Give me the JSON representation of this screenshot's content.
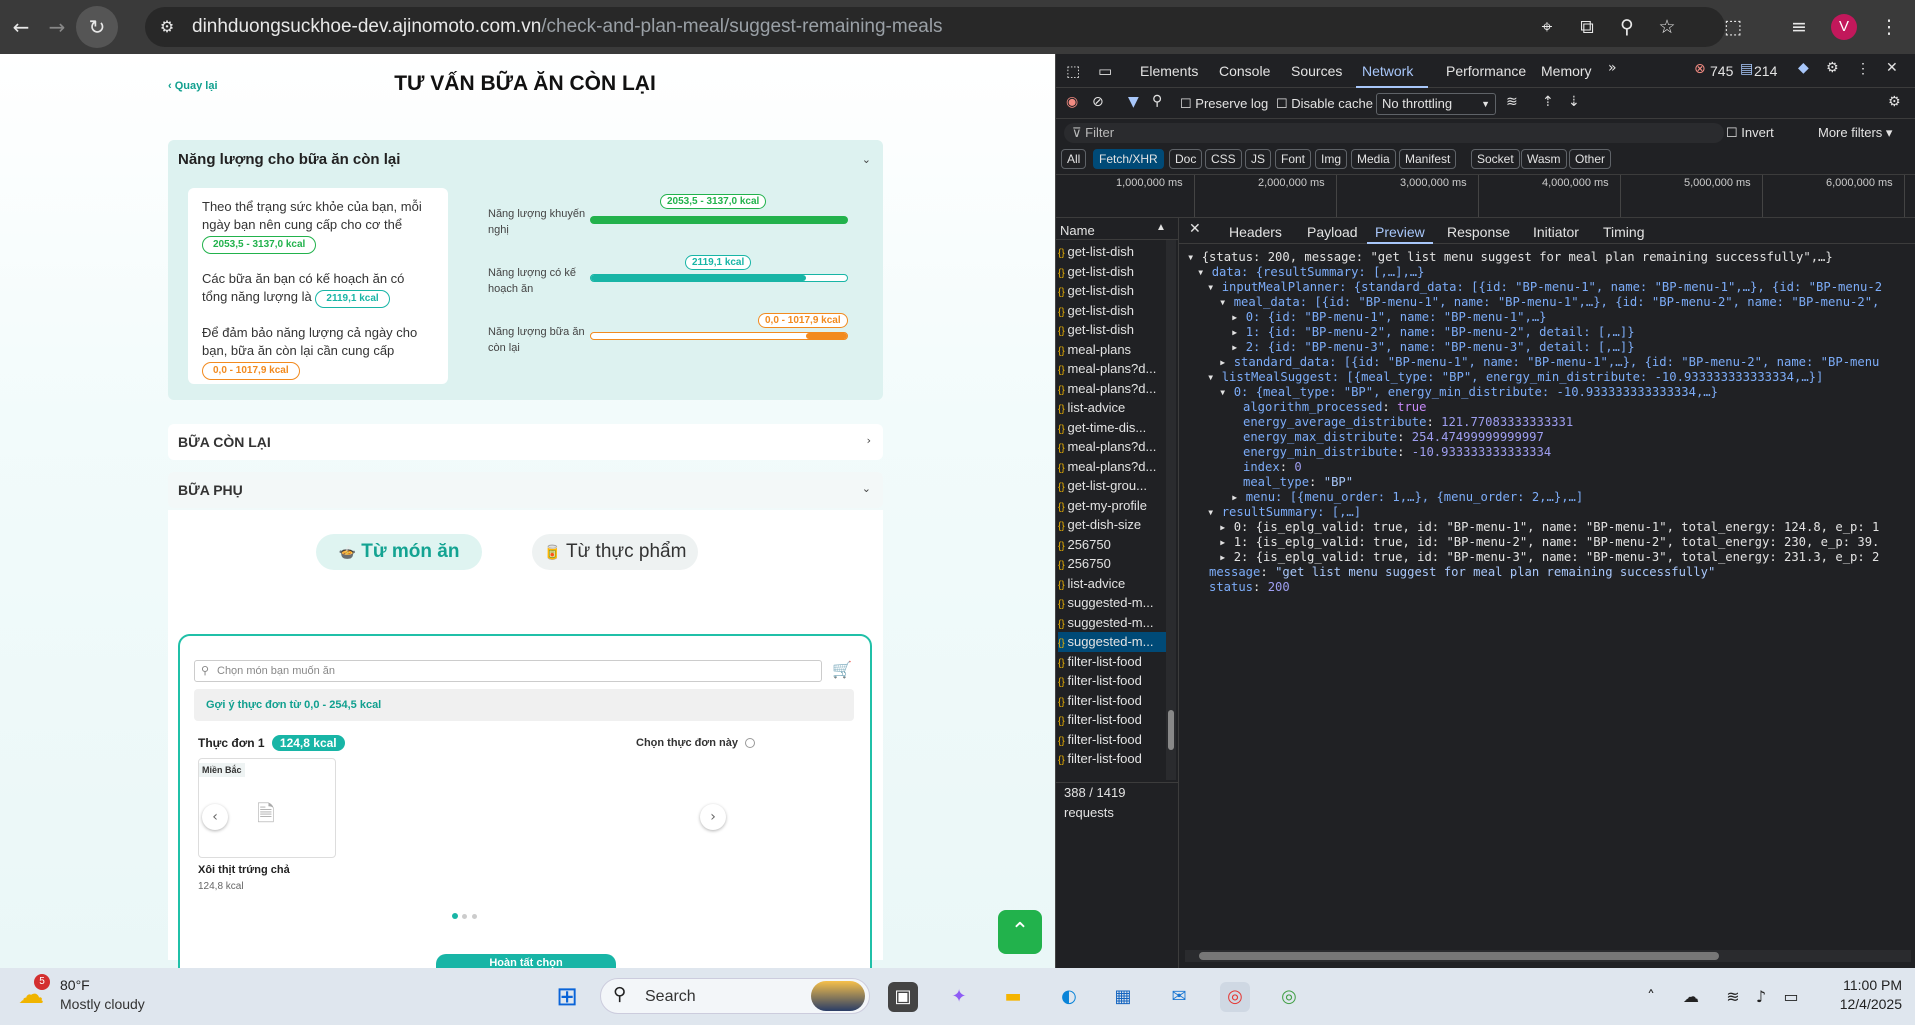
{
  "browser": {
    "url_host": "dinhduongsuckhoe-dev.ajinomoto.com.vn",
    "url_path": "/check-and-plan-meal/suggest-remaining-meals",
    "avatar_letter": "V"
  },
  "page": {
    "back_label": "Quay lại",
    "title": "TƯ VẤN BỮA ĂN CÒN LẠI",
    "energy_section": {
      "title": "Năng lượng cho bữa ăn còn lại",
      "info1_text": "Theo thể trạng sức khỏe của bạn, mỗi ngày bạn nên cung cấp cho cơ thể",
      "info1_value": "2053,5 - 3137,0 kcal",
      "info2_text": "Các bữa ăn bạn có kế hoạch ăn có tổng năng lượng là",
      "info2_value": "2119,1 kcal",
      "info3_text": "Để đảm bảo năng lượng cả ngày cho bạn, bữa ăn còn lại cần cung cấp",
      "info3_value": "0,0 - 1017,9 kcal",
      "bar1_label": "Năng lượng khuyến nghị",
      "bar1_value": "2053,5 - 3137,0 kcal",
      "bar1_fill": 1.0,
      "bar2_label": "Năng lượng có kế hoạch ăn",
      "bar2_value": "2119,1 kcal",
      "bar2_fill": 0.84,
      "bar3_label": "Năng lượng bữa ăn còn lại",
      "bar3_value": "0,0 - 1017,9 kcal",
      "bar3_fill_start": 0.84,
      "colors": {
        "green": "#22b24c",
        "teal": "#18b5a6",
        "orange": "#f28a1e"
      }
    },
    "remaining_section": "BỮA CÒN LẠI",
    "snack_section": "BỮA PHỤ",
    "tab_dish": "Từ món ăn",
    "tab_food": "Từ thực phẩm",
    "search_placeholder": "Chọn món bạn muốn ăn",
    "suggest_text": "Gợi ý thực đơn từ 0,0 - 254,5 kcal",
    "menu_title": "Thực đơn 1",
    "menu_energy": "124,8 kcal",
    "choose_menu": "Chọn thực đơn này",
    "dish_region": "Miền Bắc",
    "dish_name": "Xôi thịt trứng chả",
    "dish_energy": "124,8 kcal",
    "finish_button": "Hoàn tất chọn"
  },
  "devtools": {
    "tabs": [
      "Elements",
      "Console",
      "Sources",
      "Network",
      "Performance",
      "Memory"
    ],
    "active_tab": "Network",
    "errors": "745",
    "messages": "214",
    "preserve_log": "Preserve log",
    "disable_cache": "Disable cache",
    "throttling": "No throttling",
    "filter_placeholder": "Filter",
    "invert": "Invert",
    "more_filters": "More filters",
    "type_filters": [
      "All",
      "Fetch/XHR",
      "Doc",
      "CSS",
      "JS",
      "Font",
      "Img",
      "Media",
      "Manifest",
      "Socket",
      "Wasm",
      "Other"
    ],
    "timeline_ticks": [
      "1,000,000 ms",
      "2,000,000 ms",
      "3,000,000 ms",
      "4,000,000 ms",
      "5,000,000 ms",
      "6,000,000 ms"
    ],
    "name_header": "Name",
    "requests": [
      "get-list-dish",
      "get-list-dish",
      "get-list-dish",
      "get-list-dish",
      "get-list-dish",
      "meal-plans",
      "meal-plans?d...",
      "meal-plans?d...",
      "list-advice",
      "get-time-dis...",
      "meal-plans?d...",
      "meal-plans?d...",
      "get-list-grou...",
      "get-my-profile",
      "get-dish-size",
      "256750",
      "256750",
      "list-advice",
      "suggested-m...",
      "suggested-m...",
      "suggested-m...",
      "filter-list-food",
      "filter-list-food",
      "filter-list-food",
      "filter-list-food",
      "filter-list-food",
      "filter-list-food"
    ],
    "selected_request": 20,
    "detail_tabs": [
      "Headers",
      "Payload",
      "Preview",
      "Response",
      "Initiator",
      "Timing"
    ],
    "active_detail_tab": "Preview",
    "status_bar": "388 / 1419 requests",
    "preview": {
      "l1": "{status: 200, message: \"get list menu suggest for meal plan remaining successfully\",…}",
      "l2": "data: {resultSummary: [,…],…}",
      "l3": "inputMealPlanner: {standard_data: [{id: \"BP-menu-1\", name: \"BP-menu-1\",…}, {id: \"BP-menu-2",
      "l4": "meal_data: [{id: \"BP-menu-1\", name: \"BP-menu-1\",…}, {id: \"BP-menu-2\", name: \"BP-menu-2\",",
      "l5": "0: {id: \"BP-menu-1\", name: \"BP-menu-1\",…}",
      "l6": "1: {id: \"BP-menu-2\", name: \"BP-menu-2\", detail: [,…]}",
      "l7": "2: {id: \"BP-menu-3\", name: \"BP-menu-3\", detail: [,…]}",
      "l8": "standard_data: [{id: \"BP-menu-1\", name: \"BP-menu-1\",…}, {id: \"BP-menu-2\", name: \"BP-menu",
      "l9": "listMealSuggest: [{meal_type: \"BP\", energy_min_distribute: -10.933333333333334,…}]",
      "l10": "0: {meal_type: \"BP\", energy_min_distribute: -10.933333333333334,…}",
      "l11k": "algorithm_processed",
      "l11v": "true",
      "l12k": "energy_average_distribute",
      "l12v": "121.77083333333331",
      "l13k": "energy_max_distribute",
      "l13v": "254.47499999999997",
      "l14k": "energy_min_distribute",
      "l14v": "-10.933333333333334",
      "l15k": "index",
      "l15v": "0",
      "l16k": "meal_type",
      "l16v": "\"BP\"",
      "l17": "menu: [{menu_order: 1,…}, {menu_order: 2,…},…]",
      "l18": "resultSummary: [,…]",
      "l19": "0: {is_eplg_valid: true, id: \"BP-menu-1\", name: \"BP-menu-1\", total_energy: 124.8, e_p: 1",
      "l20": "1: {is_eplg_valid: true, id: \"BP-menu-2\", name: \"BP-menu-2\", total_energy: 230, e_p: 39.",
      "l21": "2: {is_eplg_valid: true, id: \"BP-menu-3\", name: \"BP-menu-3\", total_energy: 231.3, e_p: 2",
      "l22k": "message",
      "l22v": "\"get list menu suggest for meal plan remaining successfully\"",
      "l23k": "status",
      "l23v": "200"
    }
  },
  "taskbar": {
    "weather_badge": "5",
    "temp": "80°F",
    "condition": "Mostly cloudy",
    "search": "Search",
    "time": "11:00 PM",
    "date": "12/4/2025"
  }
}
